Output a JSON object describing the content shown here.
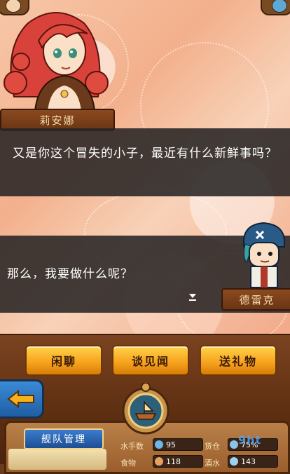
{
  "dialog": {
    "line1": "又是你这个冒失的小子，最近有什么新鲜事吗？",
    "line2": "那么，我要做什么呢？"
  },
  "characters": {
    "npc_name": "莉安娜",
    "player_name": "德雷克"
  },
  "actions": {
    "chat": "闲聊",
    "news": "谈见闻",
    "gift": "送礼物"
  },
  "fleet": {
    "tab_label": "舰队管理",
    "stats": [
      {
        "label": "水手数",
        "value": "95"
      },
      {
        "label": "货仓",
        "value": "75%"
      },
      {
        "label": "食物",
        "value": "118"
      },
      {
        "label": "酒水",
        "value": "143"
      }
    ]
  },
  "watermark": "9ht",
  "icons": {
    "back": "arrow-left-icon",
    "next": "next-arrow-icon",
    "ship": "ship-icon"
  },
  "colors": {
    "button": "#f6a11c",
    "panel": "#282424",
    "nameplate": "#7a3d18",
    "back_button": "#2a72c0"
  }
}
